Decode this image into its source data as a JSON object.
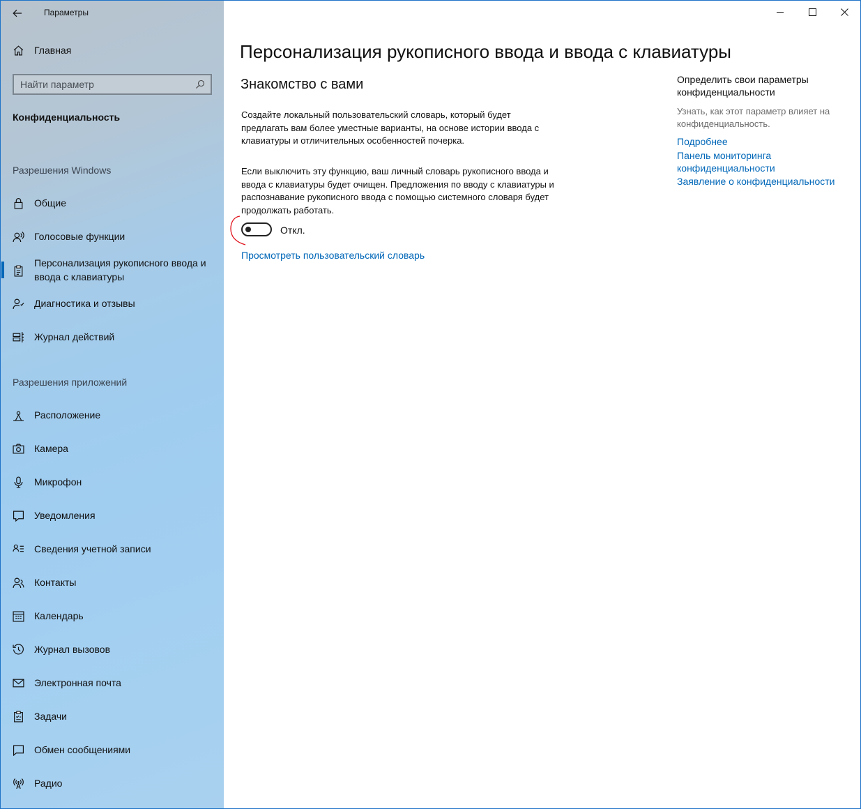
{
  "window": {
    "app_title": "Параметры"
  },
  "sidebar": {
    "home_label": "Главная",
    "search_placeholder": "Найти параметр",
    "category": "Конфиденциальность",
    "group_windows": "Разрешения Windows",
    "group_apps": "Разрешения приложений",
    "items": [
      {
        "label": "Общие",
        "icon": "lock-icon"
      },
      {
        "label": "Голосовые функции",
        "icon": "speech-icon"
      },
      {
        "label": "Персонализация рукописного ввода и ввода с клавиатуры",
        "icon": "clipboard-icon",
        "selected": true
      },
      {
        "label": "Диагностика и отзывы",
        "icon": "feedback-icon"
      },
      {
        "label": "Журнал действий",
        "icon": "timeline-icon"
      },
      {
        "label": "Расположение",
        "icon": "location-icon"
      },
      {
        "label": "Камера",
        "icon": "camera-icon"
      },
      {
        "label": "Микрофон",
        "icon": "microphone-icon"
      },
      {
        "label": "Уведомления",
        "icon": "notification-icon"
      },
      {
        "label": "Сведения учетной записи",
        "icon": "account-info-icon"
      },
      {
        "label": "Контакты",
        "icon": "contacts-icon"
      },
      {
        "label": "Календарь",
        "icon": "calendar-icon"
      },
      {
        "label": "Журнал вызовов",
        "icon": "call-history-icon"
      },
      {
        "label": "Электронная почта",
        "icon": "mail-icon"
      },
      {
        "label": "Задачи",
        "icon": "tasks-icon"
      },
      {
        "label": "Обмен сообщениями",
        "icon": "messaging-icon"
      },
      {
        "label": "Радио",
        "icon": "radio-icon"
      }
    ]
  },
  "main": {
    "title": "Персонализация рукописного ввода и ввода с клавиатуры",
    "section_title": "Знакомство с вами",
    "para1": "Создайте локальный пользовательский словарь, который будет предлагать вам более уместные варианты, на основе истории ввода с клавиатуры и отличительных особенностей почерка.",
    "para2": "Если выключить эту функцию, ваш личный словарь рукописного ввода и ввода с клавиатуры будет очищен. Предложения по вводу с клавиатуры и распознавание рукописного ввода с помощью системного словаря будет продолжать работать.",
    "toggle_state": "Откл.",
    "view_dictionary_link": "Просмотреть пользовательский словарь"
  },
  "right_panel": {
    "heading": "Определить свои параметры конфиденциальности",
    "description": "Узнать, как этот параметр влияет на конфиденциальность.",
    "links": [
      "Подробнее",
      "Панель мониторинга конфиденциальности",
      "Заявление о конфиденциальности"
    ]
  },
  "colors": {
    "accent": "#0067b8",
    "annotation": "#e0141e"
  }
}
